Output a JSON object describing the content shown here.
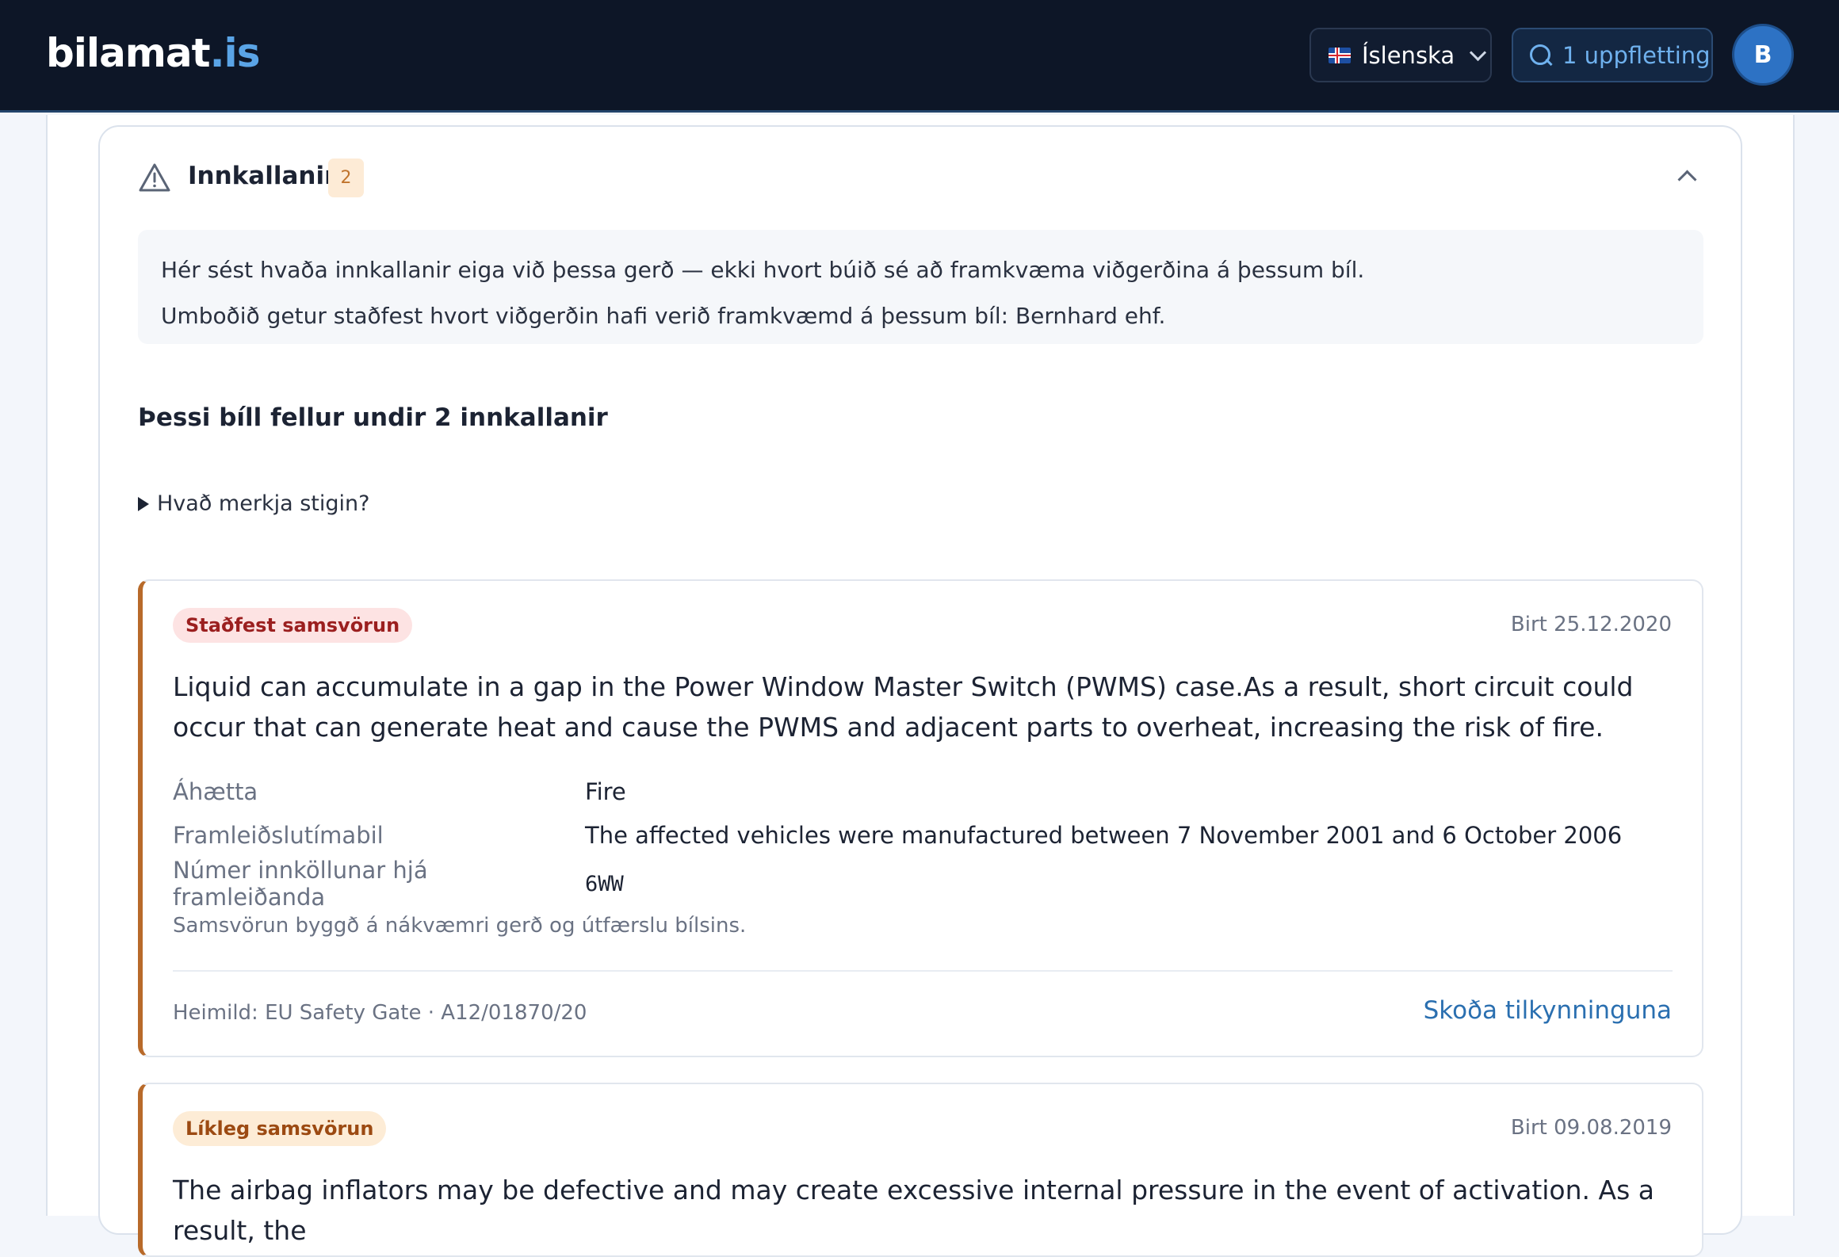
{
  "header": {
    "logo_main": "bilamat",
    "logo_tld": ".is",
    "language_label": "Íslenska",
    "lookup_label": "1 uppfletting",
    "avatar_initial": "B"
  },
  "recalls": {
    "title": "Innkallanir",
    "count": "2",
    "info_line1": "Hér sést hvaða innkallanir eiga við þessa gerð — ekki hvort búið sé að framkvæma viðgerðina á þessum bíl.",
    "info_line2": "Umboðið getur staðfest hvort viðgerðin hafi verið framkvæmd á þessum bíl: Bernhard ehf.",
    "summary_heading": "Þessi bíll fellur undir 2 innkallanir",
    "levels_toggle": "Hvað merkja stigin?",
    "items": [
      {
        "match_label": "Staðfest samsvörun",
        "published": "Birt 25.12.2020",
        "description": "Liquid can accumulate in a gap in the Power Window Master Switch (PWMS) case.As a result, short circuit could occur that can generate heat and cause the PWMS and adjacent parts to overheat, increasing the risk of fire.",
        "risk_label": "Áhætta",
        "risk_value": "Fire",
        "period_label": "Framleiðslutímabil",
        "period_value": "The affected vehicles were manufactured between 7 November 2001 and 6 October 2006",
        "number_label": "Númer innköllunar hjá framleiðanda",
        "number_value": "6WW",
        "match_note": "Samsvörun byggð á nákvæmri gerð og útfærslu bílsins.",
        "source": "Heimild: EU Safety Gate · A12/01870/20",
        "link_label": "Skoða tilkynninguna"
      },
      {
        "match_label": "Líkleg samsvörun",
        "published": "Birt 09.08.2019",
        "description": "The airbag inflators may be defective and may create excessive internal pressure in the event of activation. As a result, the"
      }
    ]
  },
  "colors": {
    "header_bg": "#0d1627",
    "accent_blue": "#2a6fb0",
    "card_border_accent": "#b86a2a",
    "confirmed_bg": "#fde3e3",
    "likely_bg": "#fdecd6"
  }
}
